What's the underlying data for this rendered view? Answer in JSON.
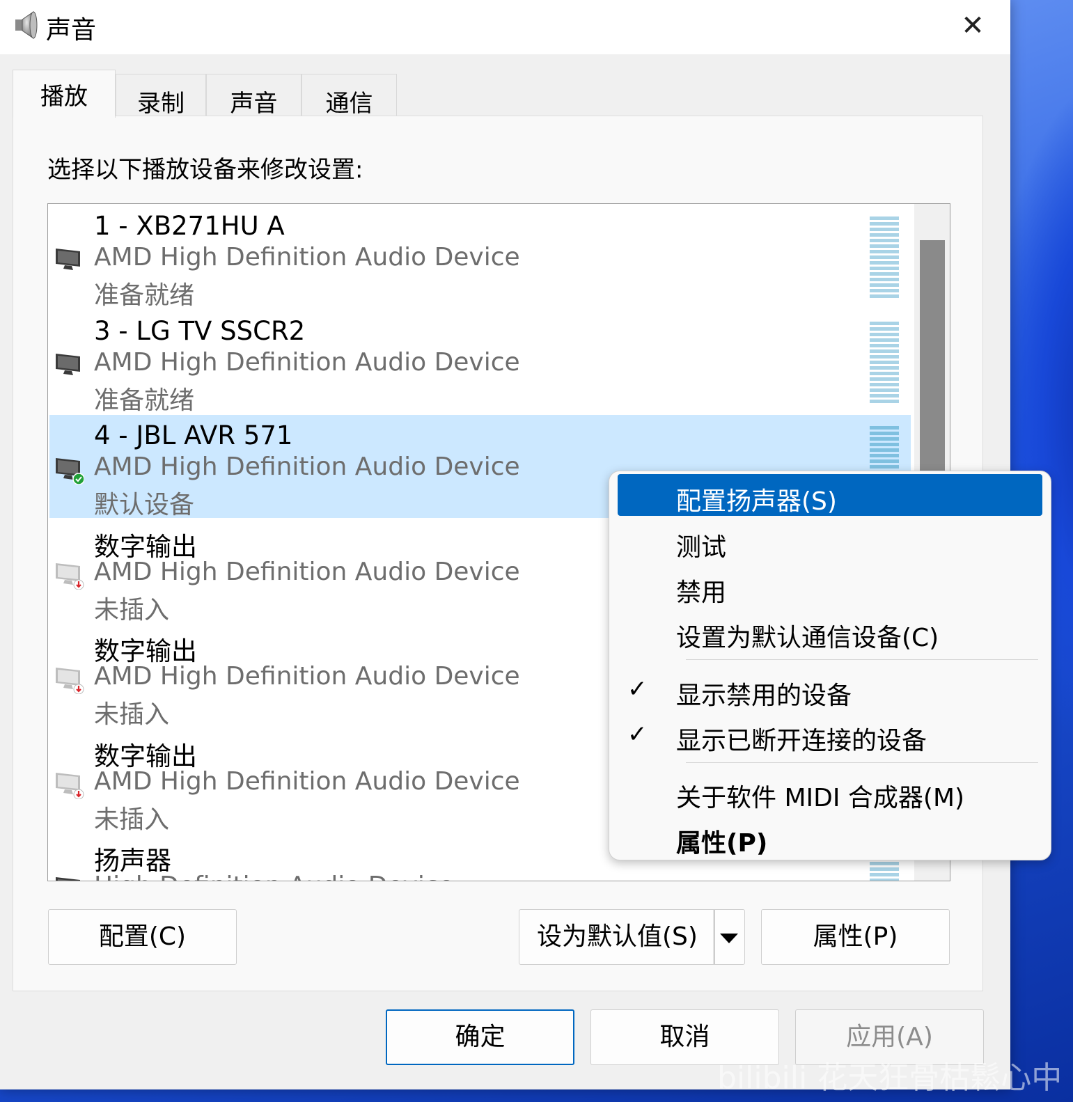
{
  "window": {
    "title": "声音",
    "close_glyph": "✕"
  },
  "tabs": [
    {
      "label": "播放",
      "active": true
    },
    {
      "label": "录制",
      "active": false
    },
    {
      "label": "声音",
      "active": false
    },
    {
      "label": "通信",
      "active": false
    }
  ],
  "instruction": "选择以下播放设备来修改设置:",
  "devices": [
    {
      "name": "1 - XB271HU A",
      "driver": "AMD High Definition Audio Device",
      "status": "准备就绪",
      "icon": "monitor-speaker-icon"
    },
    {
      "name": "3 - LG TV SSCR2",
      "driver": "AMD High Definition Audio Device",
      "status": "准备就绪",
      "icon": "monitor-speaker-icon"
    },
    {
      "name": "4 - JBL AVR 571",
      "driver": "AMD High Definition Audio Device",
      "status": "默认设备",
      "icon": "monitor-speaker-default-icon",
      "selected": true
    },
    {
      "name": "数字输出",
      "driver": "AMD High Definition Audio Device",
      "status": "未插入",
      "icon": "monitor-speaker-unplugged-icon"
    },
    {
      "name": "数字输出",
      "driver": "AMD High Definition Audio Device",
      "status": "未插入",
      "icon": "monitor-speaker-unplugged-icon"
    },
    {
      "name": "数字输出",
      "driver": "AMD High Definition Audio Device",
      "status": "未插入",
      "icon": "monitor-speaker-unplugged-icon"
    },
    {
      "name": "扬声器",
      "driver": "High Definition Audio Device",
      "status": "",
      "icon": "monitor-speaker-icon"
    }
  ],
  "buttons": {
    "configure": "配置(C)",
    "set_default": "设为默认值(S)",
    "properties": "属性(P)",
    "ok": "确定",
    "cancel": "取消",
    "apply": "应用(A)"
  },
  "context_menu": {
    "items": [
      {
        "label": "配置扬声器(S)",
        "highlighted": true
      },
      {
        "label": "测试"
      },
      {
        "label": "禁用"
      },
      {
        "label": "设置为默认通信设备(C)"
      },
      {
        "label": "显示禁用的设备",
        "checked": true
      },
      {
        "label": "显示已断开连接的设备",
        "checked": true
      },
      {
        "label": "关于软件 MIDI 合成器(M)"
      },
      {
        "label": "属性(P)",
        "bold": true
      }
    ],
    "check_glyph": "✓"
  },
  "watermark": "bilibili 花天狂骨枯鬆心中",
  "colors": {
    "accent": "#0067c0",
    "selection": "#cce8ff",
    "status_ok": "#21a038",
    "status_error": "#d9262c"
  }
}
